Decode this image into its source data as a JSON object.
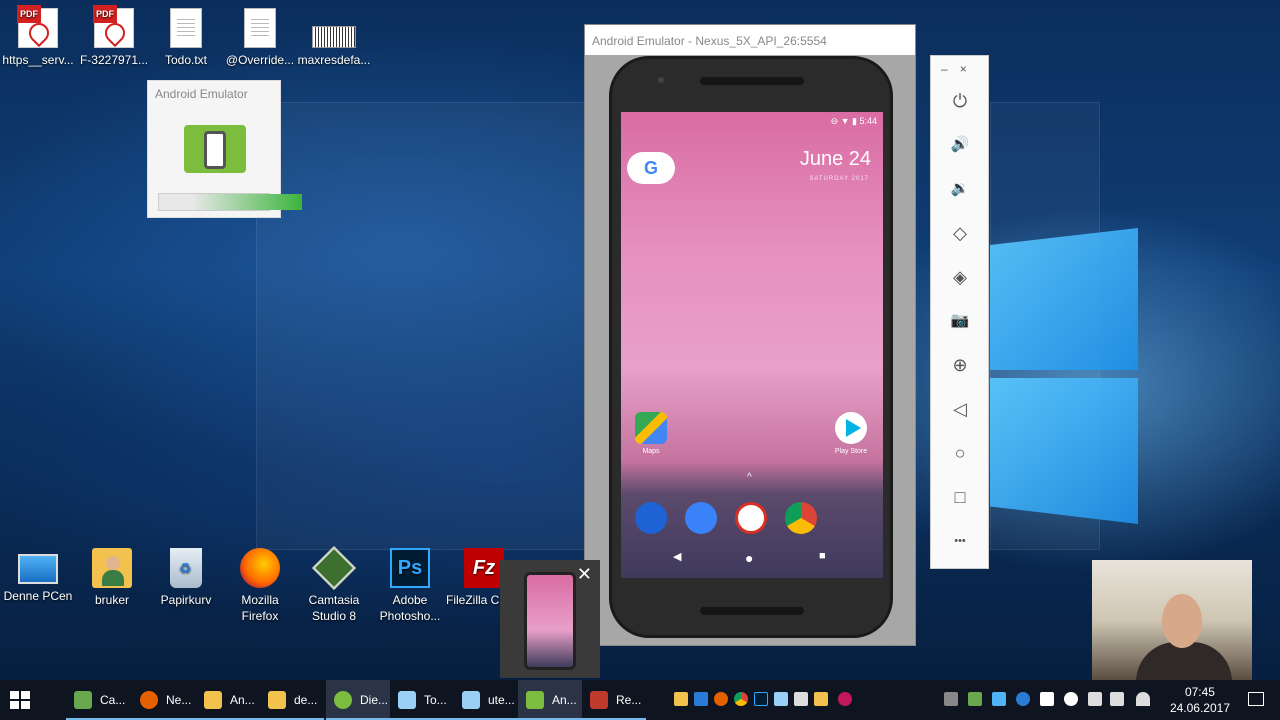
{
  "desktop": {
    "top_icons": [
      {
        "label": "https__serv...",
        "icon": "pdf-file-icon",
        "tag": "PDF"
      },
      {
        "label": "F-3227971...",
        "icon": "pdf-file-icon",
        "tag": "PDF"
      },
      {
        "label": "Todo.txt",
        "icon": "text-file-icon"
      },
      {
        "label": "@Override...",
        "icon": "text-file-icon"
      },
      {
        "label": "maxresdefa...",
        "icon": "image-file-icon"
      }
    ],
    "bottom_icons": [
      {
        "label": "Denne PCen",
        "icon": "computer-icon"
      },
      {
        "label": "bruker",
        "icon": "user-folder-icon"
      },
      {
        "label": "Papirkurv",
        "icon": "recycle-bin-icon"
      },
      {
        "label": "Mozilla Firefox",
        "icon": "firefox-icon"
      },
      {
        "label": "Camtasia Studio 8",
        "icon": "camtasia-icon"
      },
      {
        "label": "Adobe Photosho...",
        "icon": "photoshop-icon",
        "glyph": "Ps"
      },
      {
        "label": "FileZilla Client",
        "icon": "filezilla-icon",
        "glyph": "Fz"
      }
    ]
  },
  "splash": {
    "title": "Android Emulator",
    "progress": 0.7
  },
  "emulator": {
    "title": "Android Emulator - Nexus_5X_API_26:5554",
    "status_time": "5:44",
    "google_letter": "G",
    "date": "June 24",
    "day": "SATURDAY 2017",
    "apps": [
      {
        "label": "Maps"
      },
      {
        "label": "Play Store"
      }
    ],
    "chevron": "^",
    "nav": {
      "back": "◀",
      "home": "●",
      "recent": "■"
    }
  },
  "toolbar": {
    "minimize": "–",
    "close": "×",
    "buttons": [
      {
        "name": "power-button",
        "icon": "power-icon",
        "glyph": "⏻"
      },
      {
        "name": "volume-up-button",
        "icon": "volume-up-icon",
        "glyph": "🔊"
      },
      {
        "name": "volume-down-button",
        "icon": "volume-down-icon",
        "glyph": "🔉"
      },
      {
        "name": "rotate-left-button",
        "icon": "rotate-left-icon",
        "glyph": "◇"
      },
      {
        "name": "rotate-right-button",
        "icon": "rotate-right-icon",
        "glyph": "◈"
      },
      {
        "name": "screenshot-button",
        "icon": "camera-icon",
        "glyph": "📷"
      },
      {
        "name": "zoom-button",
        "icon": "zoom-icon",
        "glyph": "⊕"
      },
      {
        "name": "back-button",
        "icon": "back-icon",
        "glyph": "◁"
      },
      {
        "name": "home-button",
        "icon": "home-icon",
        "glyph": "○"
      },
      {
        "name": "overview-button",
        "icon": "overview-icon",
        "glyph": "□"
      },
      {
        "name": "more-button",
        "icon": "more-icon",
        "glyph": "•••"
      }
    ]
  },
  "thumbnail": {
    "close": "✕"
  },
  "taskbar": {
    "items": [
      {
        "label": "Ca...",
        "icon": "camtasia-icon",
        "color": "#6aa84f"
      },
      {
        "label": "Ne...",
        "icon": "firefox-icon",
        "color": "#e66000"
      },
      {
        "label": "An...",
        "icon": "folder-icon",
        "color": "#f2c14e"
      },
      {
        "label": "de...",
        "icon": "folder-icon",
        "color": "#f2c14e"
      },
      {
        "label": "Die...",
        "icon": "android-studio-icon",
        "color": "#7cbd3e"
      },
      {
        "label": "To...",
        "icon": "notepad-icon",
        "color": "#9ad0f5"
      },
      {
        "label": "ute...",
        "icon": "notepad-icon",
        "color": "#9ad0f5"
      },
      {
        "label": "An...",
        "icon": "android-emulator-icon",
        "color": "#7cbd3e"
      },
      {
        "label": "Re...",
        "icon": "camtasia-recorder-icon",
        "color": "#c0392b"
      }
    ],
    "time": "07:45",
    "date": "24.06.2017"
  }
}
